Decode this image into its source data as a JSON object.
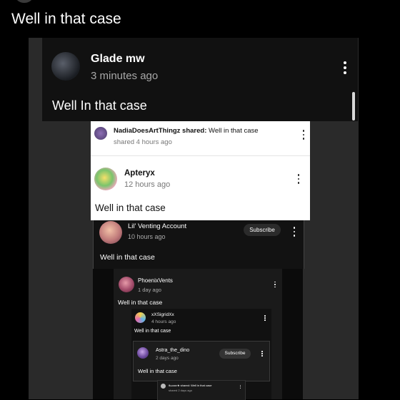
{
  "top": {
    "title": "Well in that case"
  },
  "level1": {
    "username": "Glade mw",
    "timestamp": "3 minutes ago",
    "body": "Well In that case"
  },
  "level2_share": {
    "shared_by": "NadiaDoesArtThingz shared:",
    "shared_text": "Well in that case",
    "timestamp": "shared 4 hours ago"
  },
  "level3": {
    "username": "Apteryx",
    "timestamp": "12 hours ago",
    "body": "Well in that case"
  },
  "level4": {
    "username": "Lil' Venting Account",
    "timestamp": "10 hours ago",
    "subscribe": "Subscribe",
    "body": "Well in that case"
  },
  "level5": {
    "username": "PhoenixVents",
    "timestamp": "1 day ago",
    "body": "Well in that case"
  },
  "level6": {
    "username": "xXSigridXx",
    "timestamp": "4 hours ago",
    "body": "Well in that case"
  },
  "level7": {
    "username": "Astra_the_dino",
    "timestamp": "2 days ago",
    "subscribe": "Subscribe",
    "body": "Well in that case"
  },
  "level8": {
    "shared_by": "θωααν★ shared:",
    "shared_text": "Well in that case",
    "timestamp": "shared 2 days ago"
  },
  "colors": {
    "background": "#000000",
    "panel_dark": "#2a2a2a",
    "card_dark": "#111111",
    "card_light": "#ffffff"
  }
}
